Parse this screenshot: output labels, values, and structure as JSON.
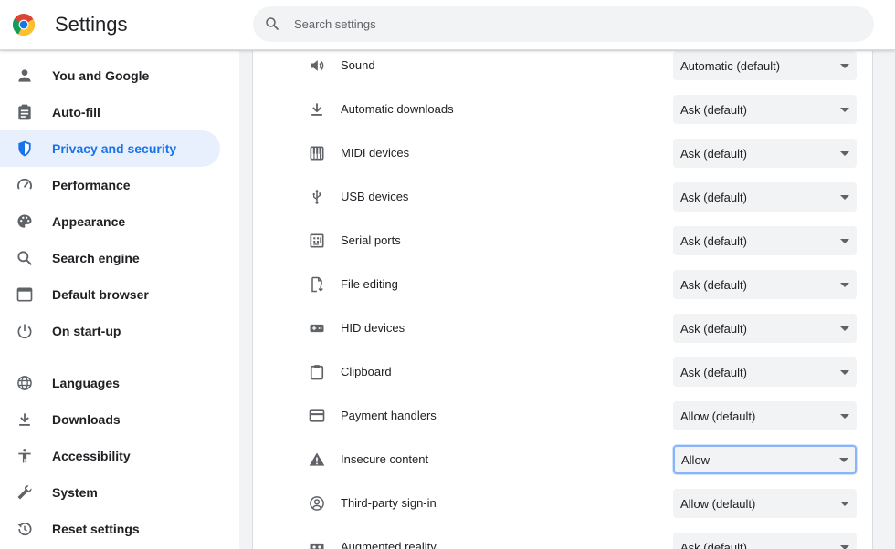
{
  "app": {
    "title": "Settings"
  },
  "search": {
    "placeholder": "Search settings"
  },
  "colors": {
    "accent": "#1a73e8",
    "active_bg": "#e8f0fe",
    "icon": "#5f6368"
  },
  "sidebar": {
    "items": [
      {
        "label": "You and Google",
        "icon": "person-icon"
      },
      {
        "label": "Auto-fill",
        "icon": "clipboard-list-icon"
      },
      {
        "label": "Privacy and security",
        "icon": "shield-icon",
        "active": true
      },
      {
        "label": "Performance",
        "icon": "speedometer-icon"
      },
      {
        "label": "Appearance",
        "icon": "palette-icon"
      },
      {
        "label": "Search engine",
        "icon": "search-icon"
      },
      {
        "label": "Default browser",
        "icon": "browser-window-icon"
      },
      {
        "label": "On start-up",
        "icon": "power-icon"
      },
      {
        "label": "Languages",
        "icon": "globe-icon"
      },
      {
        "label": "Downloads",
        "icon": "download-icon"
      },
      {
        "label": "Accessibility",
        "icon": "accessibility-icon"
      },
      {
        "label": "System",
        "icon": "wrench-icon"
      },
      {
        "label": "Reset settings",
        "icon": "history-icon"
      }
    ]
  },
  "permissions": [
    {
      "label": "Sound",
      "value": "Automatic (default)",
      "icon": "speaker-icon"
    },
    {
      "label": "Automatic downloads",
      "value": "Ask (default)",
      "icon": "download-icon"
    },
    {
      "label": "MIDI devices",
      "value": "Ask (default)",
      "icon": "piano-icon"
    },
    {
      "label": "USB devices",
      "value": "Ask (default)",
      "icon": "usb-icon"
    },
    {
      "label": "Serial ports",
      "value": "Ask (default)",
      "icon": "serial-port-icon"
    },
    {
      "label": "File editing",
      "value": "Ask (default)",
      "icon": "file-edit-icon"
    },
    {
      "label": "HID devices",
      "value": "Ask (default)",
      "icon": "gamepad-icon"
    },
    {
      "label": "Clipboard",
      "value": "Ask (default)",
      "icon": "clipboard-icon"
    },
    {
      "label": "Payment handlers",
      "value": "Allow (default)",
      "icon": "credit-card-icon"
    },
    {
      "label": "Insecure content",
      "value": "Allow",
      "icon": "warning-icon",
      "focused": true
    },
    {
      "label": "Third-party sign-in",
      "value": "Allow (default)",
      "icon": "account-circle-icon"
    },
    {
      "label": "Augmented reality",
      "value": "Ask (default)",
      "icon": "ar-icon"
    }
  ]
}
